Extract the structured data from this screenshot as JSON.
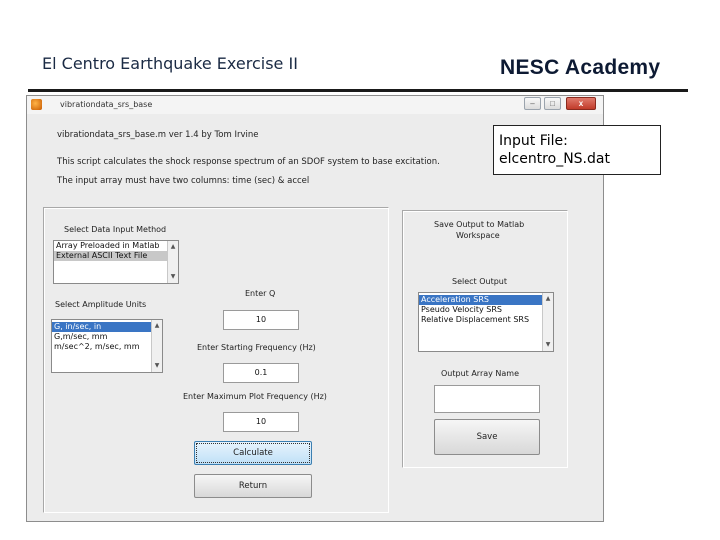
{
  "slide": {
    "title": "El Centro Earthquake Exercise II",
    "brand": "NESC Academy",
    "callout_line1": "Input File:",
    "callout_line2": "elcentro_NS.dat"
  },
  "window": {
    "title": "vibrationdata_srs_base",
    "min_glyph": "–",
    "max_glyph": "□",
    "close_glyph": "x"
  },
  "header": {
    "line1": "vibrationdata_srs_base.m   ver 1.4   by Tom Irvine",
    "line2": "This script calculates the shock response spectrum of an SDOF system to base excitation.",
    "line3": "The input array must have two columns: time (sec) & accel"
  },
  "input_method": {
    "label": "Select Data Input Method",
    "options": [
      "Array Preloaded in Matlab",
      "External ASCII Text File"
    ],
    "selected_index": 1
  },
  "units": {
    "label": "Select Amplitude Units",
    "options": [
      "G, in/sec, in",
      "G,m/sec, mm",
      "m/sec^2, m/sec, mm"
    ],
    "selected_index": 0
  },
  "fields": {
    "q_label": "Enter Q",
    "q_value": "10",
    "start_freq_label": "Enter Starting Frequency (Hz)",
    "start_freq_value": "0.1",
    "max_freq_label": "Enter Maximum Plot Frequency (Hz)",
    "max_freq_value": "10"
  },
  "buttons": {
    "calculate": "Calculate",
    "return": "Return",
    "save": "Save"
  },
  "save_panel": {
    "header_line1": "Save Output to Matlab",
    "header_line2": "Workspace",
    "output_label": "Select Output",
    "output_options": [
      "Acceleration SRS",
      "Pseudo Velocity SRS",
      "Relative Displacement SRS"
    ],
    "selected_index": 0,
    "array_name_label": "Output Array Name",
    "array_name_value": ""
  },
  "colors": {
    "selection_blue": "#3a75c4",
    "selection_grey": "#c8c8c8",
    "focus_button": "#bfe0f7"
  },
  "icons": {
    "window_icon": "matlab-icon",
    "scroll_up": "▲",
    "scroll_down": "▼"
  }
}
